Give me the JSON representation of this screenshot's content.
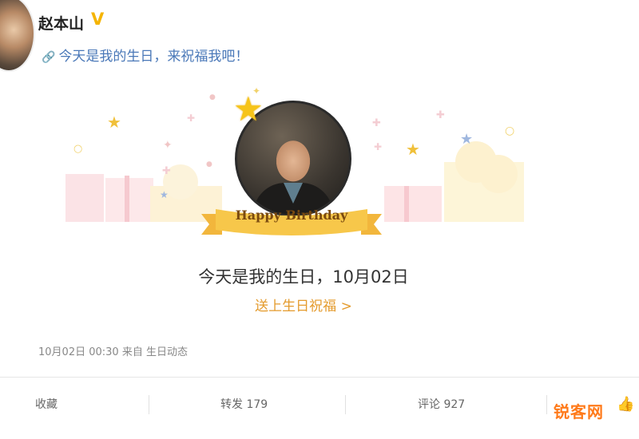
{
  "post": {
    "username": "赵本山",
    "verified_badge": "V",
    "text": "今天是我的生日，来祝福我吧！",
    "link_icon": "link-icon"
  },
  "birthday_card": {
    "ribbon_text": "Happy Birthday",
    "title": "今天是我的生日，10月02日",
    "action": "送上生日祝福 >"
  },
  "meta": {
    "timestamp_source": "10月02日 00:30 来自 生日动态"
  },
  "actions": {
    "favorite": "收藏",
    "repost": "转发 179",
    "comment": "评论 927",
    "like_icon": "thumbs-up-icon"
  },
  "watermark": "锐客网",
  "colors": {
    "link": "#4a78b8",
    "accent": "#e49b2d",
    "badge": "#f5b400",
    "ribbon": "#f5c542"
  }
}
